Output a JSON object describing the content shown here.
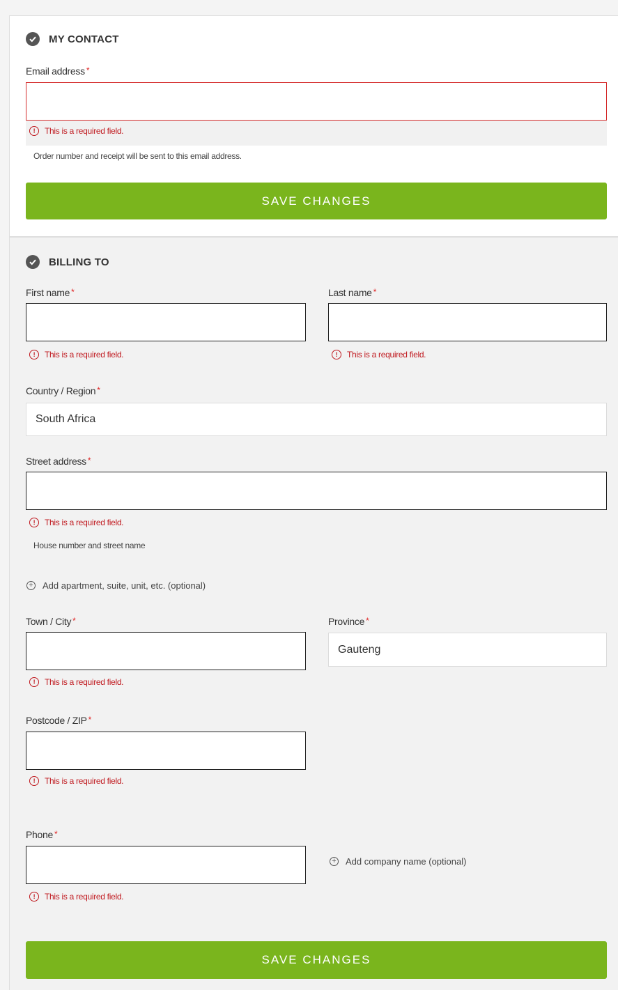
{
  "contact": {
    "title": "MY CONTACT",
    "email": {
      "label": "Email address",
      "required_mark": "*",
      "value": "",
      "error": "This is a required field.",
      "helper": "Order number and receipt will be sent to this email address."
    },
    "save_label": "SAVE CHANGES"
  },
  "billing": {
    "title": "BILLING TO",
    "first_name": {
      "label": "First name",
      "required_mark": "*",
      "value": "",
      "error": "This is a required field."
    },
    "last_name": {
      "label": "Last name",
      "required_mark": "*",
      "value": "",
      "error": "This is a required field."
    },
    "country": {
      "label": "Country / Region",
      "required_mark": "*",
      "value": "South Africa"
    },
    "street": {
      "label": "Street address",
      "required_mark": "*",
      "value": "",
      "error": "This is a required field.",
      "helper": "House number and street name"
    },
    "add_apartment": "Add apartment, suite, unit, etc. (optional)",
    "town": {
      "label": "Town / City",
      "required_mark": "*",
      "value": "",
      "error": "This is a required field."
    },
    "province": {
      "label": "Province",
      "required_mark": "*",
      "value": "Gauteng"
    },
    "postcode": {
      "label": "Postcode / ZIP",
      "required_mark": "*",
      "value": "",
      "error": "This is a required field."
    },
    "phone": {
      "label": "Phone",
      "required_mark": "*",
      "value": "",
      "error": "This is a required field."
    },
    "add_company": "Add company name (optional)",
    "save_label": "SAVE CHANGES"
  },
  "icons": {
    "section": "check-circle-icon",
    "error": "alert-circle-icon",
    "add": "plus-circle-icon"
  },
  "colors": {
    "accent_button": "#7ab51d",
    "error": "#c0191f",
    "required": "#e02020"
  }
}
